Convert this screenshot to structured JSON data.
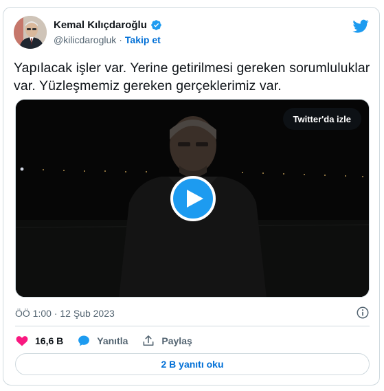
{
  "author": {
    "display_name": "Kemal Kılıçdaroğlu",
    "handle": "@kilicdarogluk",
    "separator": "·",
    "follow_label": "Takip et"
  },
  "tweet": {
    "text": "Yapılacak işler var. Yerine getirilmesi gereken sorumluluklar var. Yüzleşmemiz gereken gerçeklerimiz var."
  },
  "media": {
    "watch_label": "Twitter'da izle"
  },
  "meta": {
    "timestamp": "ÖÖ 1:00 · 12 Şub 2023"
  },
  "actions": {
    "likes": "16,6 B",
    "reply_label": "Yanıtla",
    "share_label": "Paylaş"
  },
  "replies": {
    "label": "2 B yanıtı oku"
  },
  "icons": {
    "verified": "verified-badge-icon",
    "brand": "twitter-bird-icon",
    "play": "play-icon",
    "info": "info-icon",
    "like": "heart-icon",
    "reply": "speech-bubble-icon",
    "share": "share-upload-icon"
  },
  "colors": {
    "accent": "#1d9bf0",
    "link": "#006fd6",
    "like": "#f91880",
    "border": "#cfd9de",
    "secondary_text": "#536471"
  }
}
